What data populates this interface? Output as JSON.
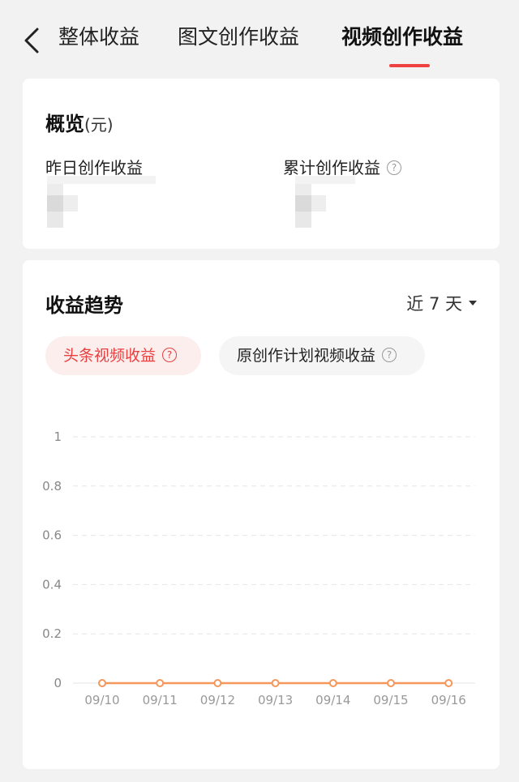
{
  "tabs": [
    {
      "label": "整体收益",
      "active": false
    },
    {
      "label": "图文创作收益",
      "active": false
    },
    {
      "label": "视频创作收益",
      "active": true
    }
  ],
  "overview": {
    "title": "概览",
    "unit": "(元)",
    "yesterday_label": "昨日创作收益",
    "total_label": "累计创作收益"
  },
  "trend": {
    "title": "收益趋势",
    "range_label": "近 7 天",
    "chips": [
      {
        "label": "头条视频收益",
        "active": true
      },
      {
        "label": "原创作计划视频收益",
        "active": false
      }
    ]
  },
  "colors": {
    "accent": "#f04142",
    "line": "#f5965a"
  },
  "icons": {
    "back": "chevron-left-icon",
    "help": "question-circle-icon",
    "dropdown": "caret-down-icon"
  },
  "chart_data": {
    "type": "line",
    "x": [
      "09/10",
      "09/11",
      "09/12",
      "09/13",
      "09/14",
      "09/15",
      "09/16"
    ],
    "series": [
      {
        "values": [
          0,
          0,
          0,
          0,
          0,
          0,
          0
        ]
      }
    ],
    "yticks": [
      "1",
      "0.8",
      "0.6",
      "0.4",
      "0.2",
      "0"
    ],
    "ylim": [
      0,
      1
    ],
    "grid": true,
    "legend": "none"
  }
}
